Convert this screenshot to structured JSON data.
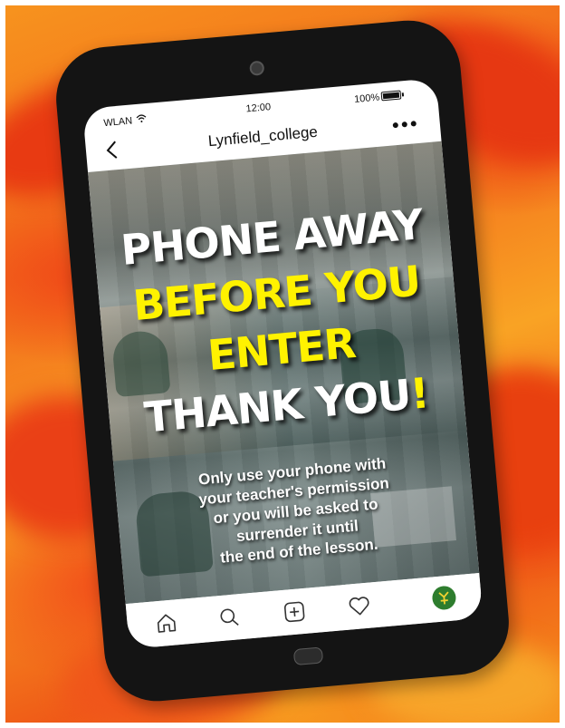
{
  "status_bar": {
    "carrier": "WLAN",
    "time": "12:00",
    "battery": "100%"
  },
  "header": {
    "account_name": "Lynfield_college"
  },
  "post": {
    "headline_line1": "PHONE AWAY",
    "headline_line2": "BEFORE YOU",
    "headline_line3": "ENTER",
    "headline_line4": "THANK YOU",
    "headline_exclaim": "!",
    "caption_lines": [
      "Only use your phone with",
      "your teacher's permission",
      "or you will be asked to",
      "surrender it until",
      "the end of the lesson."
    ]
  },
  "nav": {
    "icons": [
      "home-icon",
      "search-icon",
      "add-post-icon",
      "heart-icon",
      "profile-avatar"
    ]
  },
  "colors": {
    "background_orange": "#f7931e",
    "background_red": "#ef4a17",
    "headline_yellow": "#fff200",
    "headline_white": "#ffffff",
    "phone_body": "#141414"
  }
}
